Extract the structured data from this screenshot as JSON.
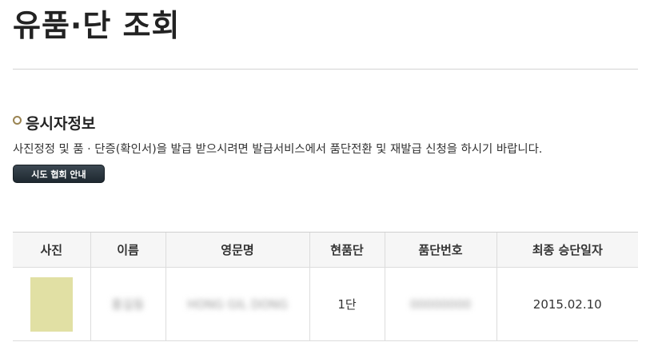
{
  "page": {
    "title": "유품·단 조회"
  },
  "applicant_section": {
    "heading": "응시자정보",
    "notice": "사진정정 및 품 · 단증(확인서)을 발급 받으시려면 발급서비스에서 품단전환 및 재발급 신청을 하시기 바랍니다.",
    "guide_button_label": "시도 협회 안내"
  },
  "table": {
    "columns": [
      "사진",
      "이름",
      "영문명",
      "현품단",
      "품단번호",
      "최종 승단일자"
    ],
    "rows": [
      {
        "photo_color": "#e1e0a4",
        "name": "홍길동",
        "english_name": "HONG GIL DONG",
        "current_rank": "1단",
        "rank_number": "00000000",
        "last_promotion_date": "2015.02.10"
      }
    ]
  }
}
